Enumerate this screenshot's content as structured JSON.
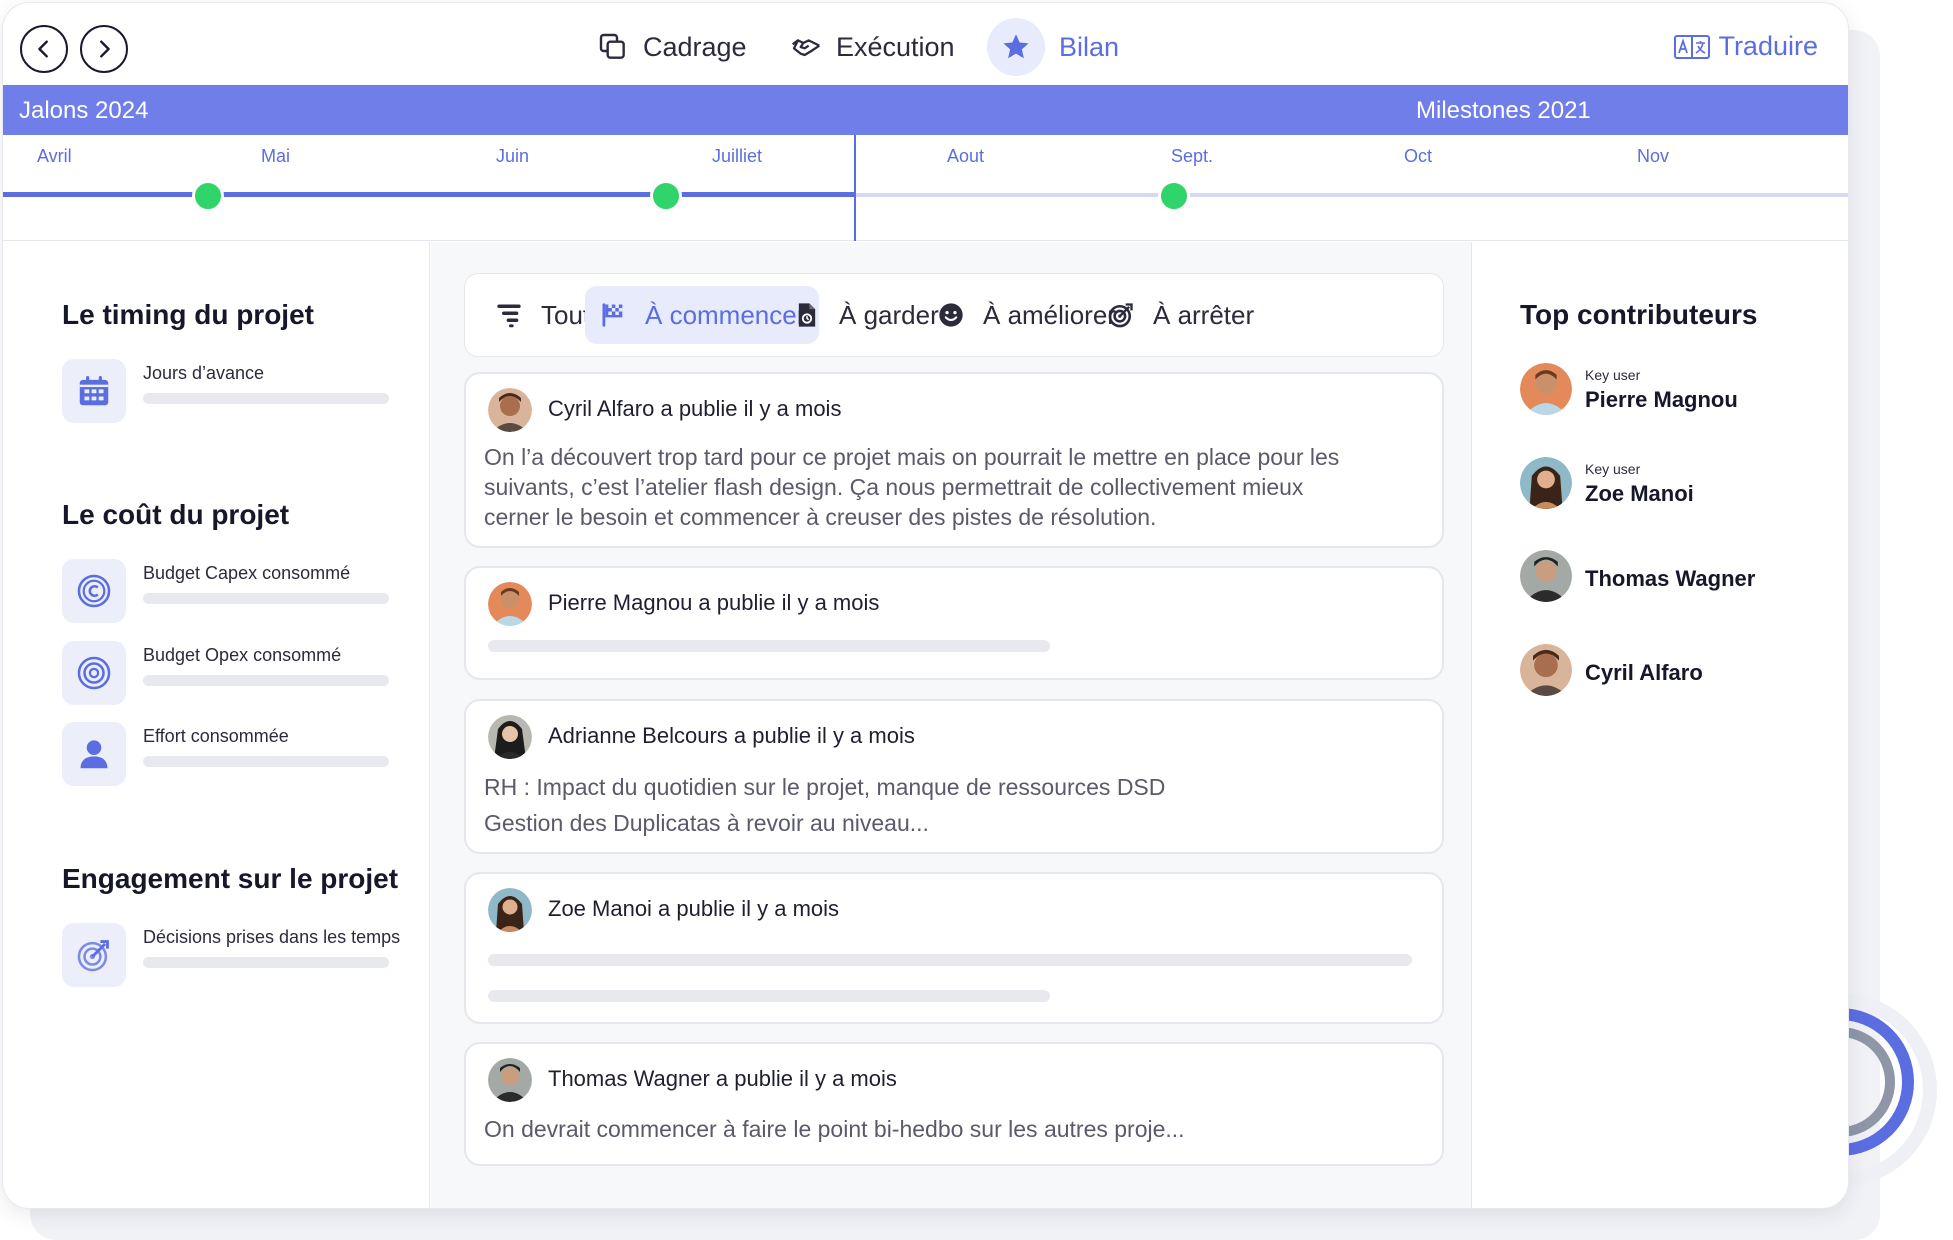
{
  "header": {
    "stages": [
      {
        "label": "Cadrage",
        "icon": "copy-icon"
      },
      {
        "label": "Exécution",
        "icon": "handshake-icon"
      },
      {
        "label": "Bilan",
        "icon": "star-icon",
        "active": true
      }
    ],
    "translate_label": "Traduire"
  },
  "timeline": {
    "left_title": "Jalons 2024",
    "right_title": "Milestones 2021",
    "months": [
      "Avril",
      "Mai",
      "Juin",
      "Juilliet",
      "Aout",
      "Sept.",
      "Oct",
      "Nov"
    ]
  },
  "left_panel": {
    "timing": {
      "title": "Le timing du projet",
      "metrics": [
        {
          "label": "Jours d’avance",
          "icon": "calendar-icon"
        }
      ]
    },
    "cost": {
      "title": "Le coût du projet",
      "metrics": [
        {
          "label": "Budget Capex consommé",
          "icon": "coin-icon"
        },
        {
          "label": "Budget Opex consommé",
          "icon": "coins-stack-icon"
        },
        {
          "label": "Effort consommée",
          "icon": "user-icon"
        }
      ]
    },
    "engagement": {
      "title": "Engagement sur le projet",
      "metrics": [
        {
          "label": "Décisions prises dans les temps",
          "icon": "target-icon"
        }
      ]
    }
  },
  "filters": {
    "tabs": [
      {
        "label": "Tout",
        "icon": "filter-icon"
      },
      {
        "label": "À commencer",
        "icon": "flag-icon",
        "active": true
      },
      {
        "label": "À garder",
        "icon": "document-icon"
      },
      {
        "label": "À améliorer",
        "icon": "smiley-icon"
      },
      {
        "label": "À arrêter",
        "icon": "target-icon"
      }
    ]
  },
  "posts": [
    {
      "author": "Cyril Alfaro a publie il y a mois",
      "lines": [
        "On l’a découvert trop tard pour ce projet mais on pourrait le mettre en place pour les",
        "suivants, c’est l’atelier flash design. Ça nous permettrait de collectivement mieux",
        "cerner le besoin et commencer à creuser des pistes de résolution."
      ]
    },
    {
      "author": "Pierre Magnou a publie il y a mois",
      "lines": []
    },
    {
      "author": "Adrianne Belcours a publie il y a mois",
      "lines": [
        "RH : Impact du quotidien sur le projet, manque de ressources DSD",
        "Gestion des Duplicatas à revoir au niveau..."
      ]
    },
    {
      "author": "Zoe Manoi a publie il y a mois",
      "lines": []
    },
    {
      "author": "Thomas Wagner a publie il y a mois",
      "lines": [
        "On devrait commencer à faire le point bi-hedbo sur les autres proje..."
      ]
    }
  ],
  "contributors": {
    "title": "Top contributeurs",
    "items": [
      {
        "role": "Key user",
        "name": "Pierre Magnou"
      },
      {
        "role": "Key user",
        "name": "Zoe Manoi"
      },
      {
        "role": "",
        "name": "Thomas Wagner"
      },
      {
        "role": "",
        "name": "Cyril Alfaro"
      }
    ]
  },
  "colors": {
    "accent": "#5b6ee1",
    "band": "#6f7ee8",
    "accent_soft": "#e8ebfb",
    "milestone": "#2fd46a",
    "placeholder": "#e8e9ee"
  }
}
